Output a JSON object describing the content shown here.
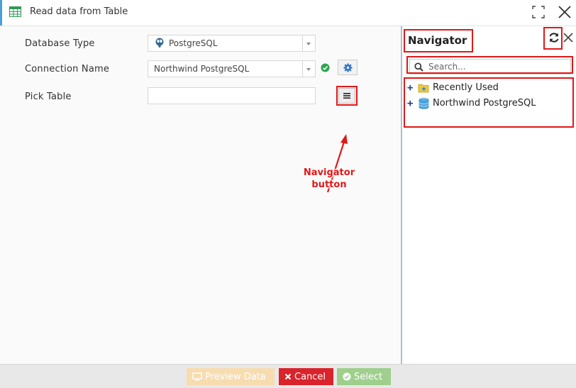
{
  "window": {
    "title": "Read data from Table",
    "icon": "table-icon",
    "controls": {
      "maximize_icon": "maximize-icon",
      "close_icon": "close-icon"
    }
  },
  "form": {
    "database_type": {
      "label": "Database Type",
      "value": "PostgreSQL",
      "icon": "postgresql-icon"
    },
    "connection_name": {
      "label": "Connection Name",
      "value": "Northwind PostgreSQL",
      "status_icon": "check-circle-icon",
      "settings_icon": "gear-icon"
    },
    "pick_table": {
      "label": "Pick Table",
      "value": "",
      "button_icon": "menu-icon"
    }
  },
  "annotation": {
    "line1": "Navigator",
    "line2": "button",
    "color": "#e01818"
  },
  "navigator": {
    "title": "Navigator",
    "refresh_icon": "refresh-icon",
    "close_icon": "close-icon",
    "search": {
      "placeholder": "Search...",
      "value": ""
    },
    "tree": [
      {
        "label": "Recently Used",
        "icon": "folder-star-icon",
        "expander": "+"
      },
      {
        "label": "Northwind PostgreSQL",
        "icon": "database-icon",
        "expander": "+"
      }
    ]
  },
  "footer": {
    "preview_label": "Preview Data",
    "cancel_label": "Cancel",
    "select_label": "Select"
  },
  "colors": {
    "accent": "#4a9fd9",
    "cancel": "#d9242b",
    "select": "#9fcf8c",
    "preview": "#f7dcb0",
    "highlight": "#e01818"
  }
}
